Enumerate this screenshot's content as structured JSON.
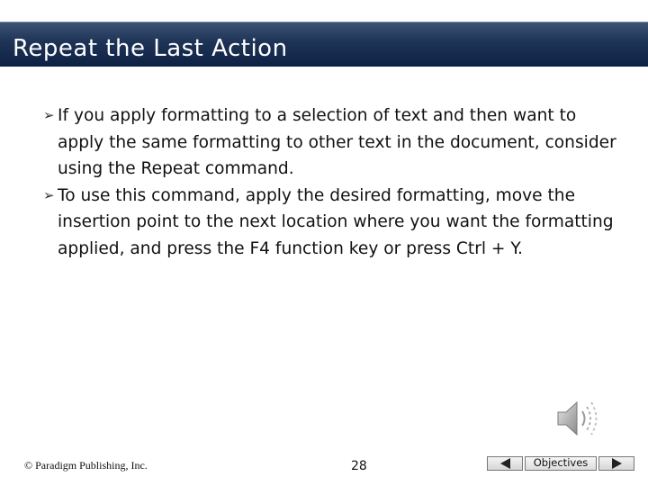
{
  "slide": {
    "title": "Repeat the Last Action",
    "bullets": [
      "If you apply formatting to a selection of text and then want to apply the same formatting to other text in the document, consider using the Repeat command.",
      "To use this command, apply the desired formatting, move the insertion point to the next location where you want the formatting applied, and press the F4 function key or press Ctrl + Y."
    ],
    "bullet_glyph": "➢"
  },
  "footer": {
    "copyright": "© Paradigm Publishing, Inc.",
    "page_number": "28",
    "nav_label": "Objectives"
  },
  "icons": {
    "audio": "speaker-icon",
    "back": "triangle-left-icon",
    "next": "triangle-right-icon"
  },
  "colors": {
    "title_bar": "#1d3356",
    "title_text": "#ffffff"
  }
}
